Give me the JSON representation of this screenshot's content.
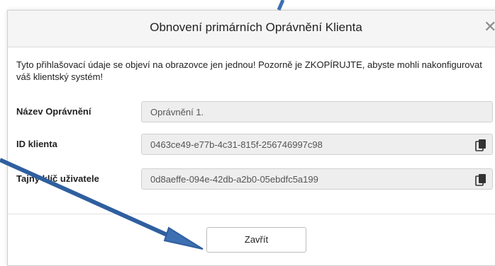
{
  "dialog": {
    "title": "Obnovení primárních Oprávnění Klienta",
    "close_icon": "close-icon",
    "info_text": "Tyto přihlašovací údaje se objeví na obrazovce jen jednou! Pozorně je ZKOPÍRUJTE, abyste mohli nakonfigurovat váš klientský systém!",
    "fields": [
      {
        "label": "Název Oprávnění",
        "value": "Oprávnění 1."
      },
      {
        "label": "ID klienta",
        "value": "0463ce49-e77b-4c31-815f-256746997c98",
        "icon": "copy-icon"
      },
      {
        "label": "Tajný klíč uživatele",
        "value": "0d8aeffe-094e-42db-a2b0-05ebdfc5a199",
        "icon": "copy-icon"
      }
    ],
    "close_button_label": "Zavřít"
  },
  "colors": {
    "arrow": "#3d6fb3",
    "header_bg": "#f5f5f5",
    "field_bg": "#eeeeee"
  }
}
